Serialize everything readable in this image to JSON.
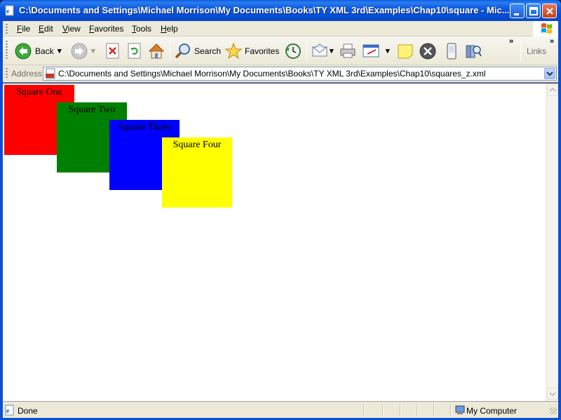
{
  "window": {
    "title": "C:\\Documents and Settings\\Michael Morrison\\My Documents\\Books\\TY XML 3rd\\Examples\\Chap10\\square - Mic..."
  },
  "menu": {
    "items": [
      {
        "label": "File",
        "accel": "F",
        "rest": "ile"
      },
      {
        "label": "Edit",
        "accel": "E",
        "rest": "dit"
      },
      {
        "label": "View",
        "accel": "V",
        "rest": "iew"
      },
      {
        "label": "Favorites",
        "accel": "F",
        "rest": "avorites"
      },
      {
        "label": "Tools",
        "accel": "T",
        "rest": "ools"
      },
      {
        "label": "Help",
        "accel": "H",
        "rest": "elp"
      }
    ]
  },
  "toolbar": {
    "back_label": "Back",
    "search_label": "Search",
    "favorites_label": "Favorites",
    "links_label": "Links",
    "overflow": "»"
  },
  "address": {
    "label": "Address",
    "url": "C:\\Documents and Settings\\Michael Morrison\\My Documents\\Books\\TY XML 3rd\\Examples\\Chap10\\squares_z.xml"
  },
  "page": {
    "squares": [
      {
        "label": "Square One",
        "color": "#ff0000"
      },
      {
        "label": "Square Two",
        "color": "#008000"
      },
      {
        "label": "Square Three",
        "color": "#0000ff"
      },
      {
        "label": "Square Four",
        "color": "#ffff00"
      }
    ]
  },
  "status": {
    "text": "Done",
    "zone": "My Computer"
  },
  "colors": {
    "titlebar": "#0c5ae0",
    "chrome": "#ece9d8"
  },
  "icons": [
    "ie-page-icon",
    "minimize-icon",
    "maximize-icon",
    "close-icon",
    "windows-logo-icon",
    "back-arrow-icon",
    "forward-arrow-icon",
    "stop-icon",
    "refresh-icon",
    "home-icon",
    "search-icon",
    "favorites-star-icon",
    "history-icon",
    "mail-icon",
    "print-icon",
    "edit-icon",
    "note-icon",
    "close-circle-icon",
    "device-icon",
    "research-icon",
    "my-computer-icon"
  ]
}
